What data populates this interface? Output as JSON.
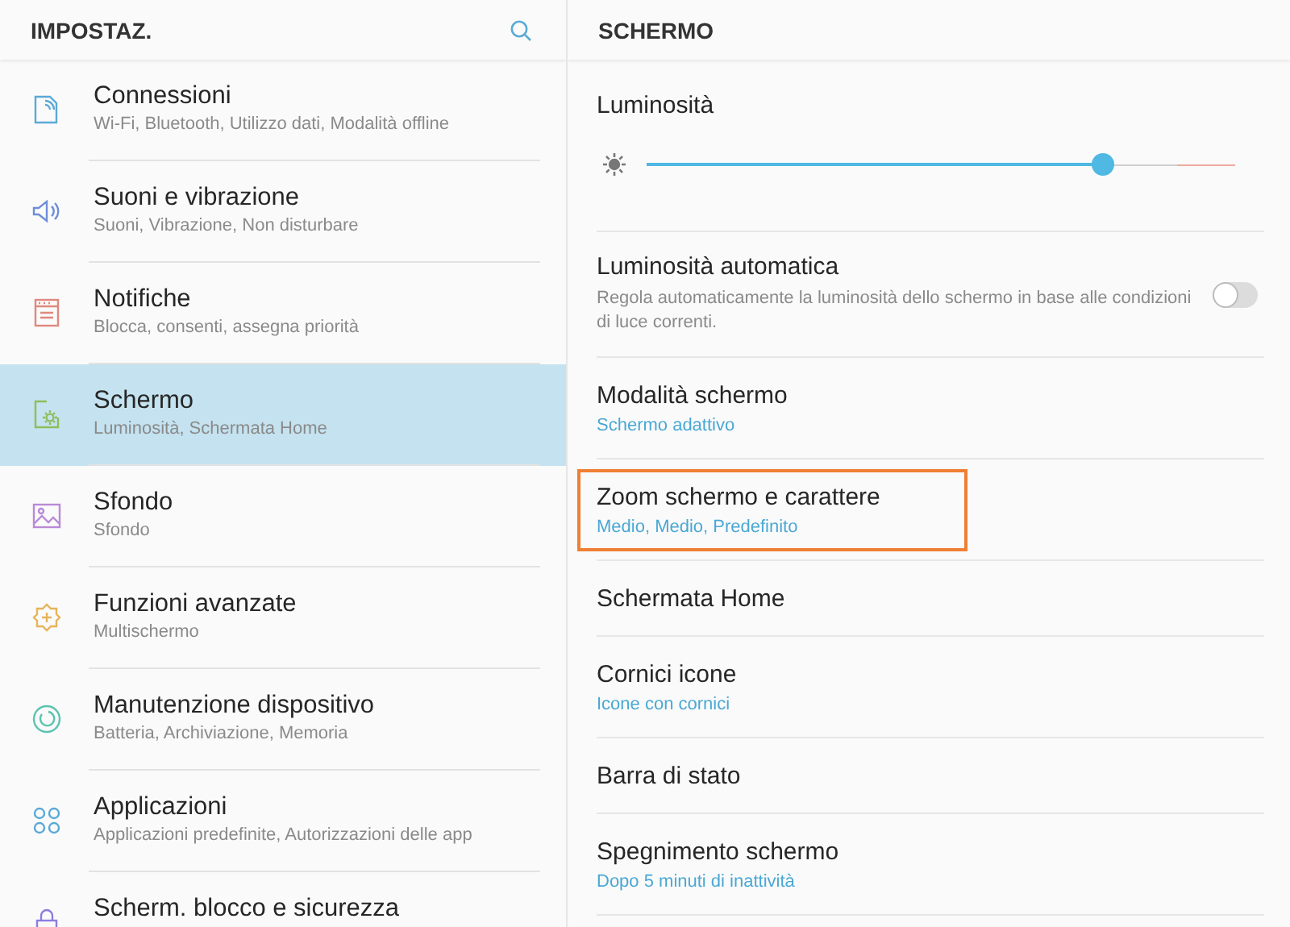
{
  "sidebar": {
    "title": "IMPOSTAZ.",
    "items": [
      {
        "title": "Connessioni",
        "subtitle": "Wi-Fi, Bluetooth, Utilizzo dati, Modalità offline",
        "selected": false
      },
      {
        "title": "Suoni e vibrazione",
        "subtitle": "Suoni, Vibrazione, Non disturbare",
        "selected": false
      },
      {
        "title": "Notifiche",
        "subtitle": "Blocca, consenti, assegna priorità",
        "selected": false
      },
      {
        "title": "Schermo",
        "subtitle": "Luminosità, Schermata Home",
        "selected": true
      },
      {
        "title": "Sfondo",
        "subtitle": "Sfondo",
        "selected": false
      },
      {
        "title": "Funzioni avanzate",
        "subtitle": "Multischermo",
        "selected": false
      },
      {
        "title": "Manutenzione dispositivo",
        "subtitle": "Batteria, Archiviazione, Memoria",
        "selected": false
      },
      {
        "title": "Applicazioni",
        "subtitle": "Applicazioni predefinite, Autorizzazioni delle app",
        "selected": false
      },
      {
        "title": "Scherm. blocco e sicurezza",
        "selected": false
      }
    ]
  },
  "panel": {
    "title": "SCHERMO",
    "items": [
      {
        "kind": "slider",
        "title": "Luminosità",
        "level": 0.775
      },
      {
        "kind": "toggle",
        "title": "Luminosità automatica",
        "description": "Regola automaticamente la luminosità dello schermo in base alle condizioni di luce correnti.",
        "on": false
      },
      {
        "kind": "plain",
        "title": "Modalità schermo",
        "value": "Schermo adattivo",
        "highlighted": false
      },
      {
        "kind": "plain",
        "title": "Zoom schermo e carattere",
        "value": "Medio, Medio, Predefinito",
        "highlighted": true
      },
      {
        "kind": "plain",
        "title": "Schermata Home",
        "highlighted": false
      },
      {
        "kind": "plain",
        "title": "Cornici icone",
        "value": "Icone con cornici",
        "highlighted": false
      },
      {
        "kind": "plain",
        "title": "Barra di stato",
        "highlighted": false
      },
      {
        "kind": "plain",
        "title": "Spegnimento schermo",
        "value": "Dopo 5 minuti di inattività",
        "highlighted": false
      }
    ]
  }
}
